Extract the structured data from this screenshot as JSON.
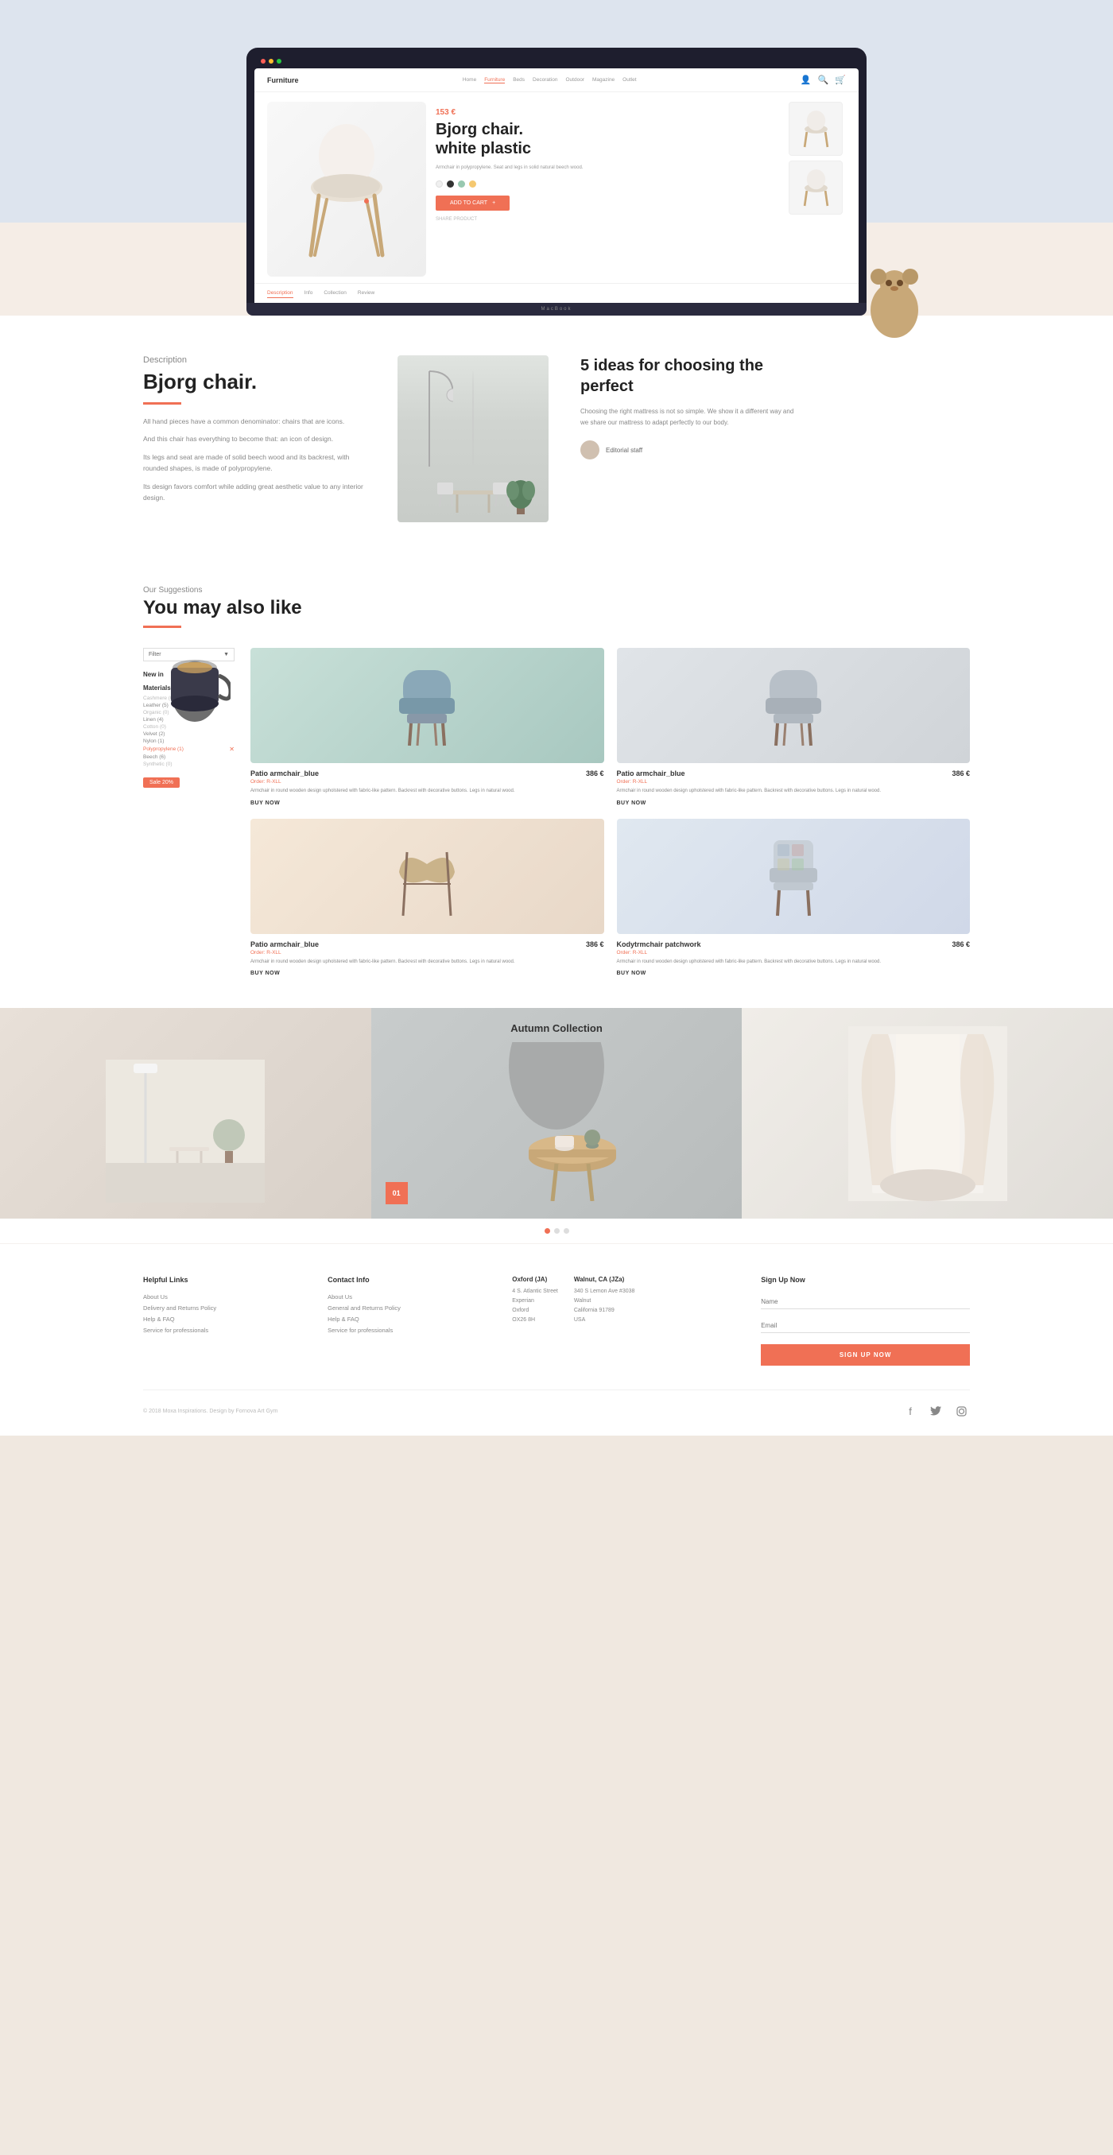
{
  "brand": {
    "logo": "Furniture"
  },
  "nav": {
    "links": [
      "Home",
      "Furniture",
      "Beds",
      "Decoration",
      "Outdoor",
      "Magazine",
      "Outlet"
    ],
    "active": "Furniture"
  },
  "product": {
    "price": "153 €",
    "title_line1": "Bjorg chair.",
    "title_line2": "white plastic",
    "description": "Armchair in polypropylene. Seat and legs in solid natural beech wood.",
    "colors": [
      "#f0f0f0",
      "#333333",
      "#c8d8c8",
      "#f5c870"
    ],
    "add_to_cart": "ADD TO CART",
    "share": "SHARE PRODUCT"
  },
  "description_section": {
    "label": "Description",
    "title": "Bjorg chair.",
    "paragraphs": [
      "All hand pieces have a common denominator: chairs that are icons.",
      "And this chair has everything to become that: an icon of design.",
      "Its legs and seat are made of solid beech wood and its backrest, with rounded shapes, is made of polypropylene.",
      "Its design favors comfort while adding great aesthetic value to any interior design."
    ],
    "ideas_title": "5 ideas for choosing the perfect",
    "ideas_text": "Choosing the right mattress is not so simple. We show it a different way and we share our mattress to adapt perfectly to our body.",
    "editorial_staff": "Editorial staff"
  },
  "suggestions": {
    "label": "Our Suggestions",
    "title": "You may also like",
    "filter_label": "Filter",
    "filter_sections": [
      {
        "title": "New in",
        "items": []
      },
      {
        "title": "Materials",
        "items": [
          {
            "label": "Cashmere (0)",
            "count": 0
          },
          {
            "label": "Leather (5)",
            "count": 5
          },
          {
            "label": "Organic (0)",
            "count": 0
          },
          {
            "label": "Linen (4)",
            "count": 4
          },
          {
            "label": "Cotton (0)",
            "count": 0
          },
          {
            "label": "Velvet (2)",
            "count": 2
          },
          {
            "label": "Nylon (1)",
            "count": 1
          },
          {
            "label": "Polypropylene (1)",
            "count": 1,
            "selected": true
          },
          {
            "label": "Beech (6)",
            "count": 6
          },
          {
            "label": "Synthetic (0)",
            "count": 0
          }
        ]
      }
    ],
    "sale_label": "Sale 20%",
    "products": [
      {
        "name": "Patio armchair_blue",
        "price": "386 €",
        "subtitle": "Order: R-XLL",
        "description": "Armchair in round wooden design upholstered with fabric-like pattern. Backrest with decorative buttons. Legs in natural wood.",
        "buy_now": "BUY NOW",
        "color": "blue-green"
      },
      {
        "name": "Patio armchair_blue",
        "price": "386 €",
        "subtitle": "Order: R-XLL",
        "description": "Armchair in round wooden design upholstered with fabric-like pattern. Backrest with decorative buttons. Legs in natural wood.",
        "buy_now": "BUY NOW",
        "color": "light-gray"
      },
      {
        "name": "Patio armchair_blue",
        "price": "386 €",
        "subtitle": "Order: R-XLL",
        "description": "Armchair in round wooden design upholstered with fabric-like pattern. Backrest with decorative buttons. Legs in natural wood.",
        "buy_now": "BUY NOW",
        "color": "peach"
      },
      {
        "name": "Kodytrmchair patchwork",
        "price": "386 €",
        "subtitle": "Order: R-XLL",
        "description": "Armchair in round wooden design upholstered with fabric-like pattern. Backrest with decorative buttons. Legs in natural wood.",
        "buy_now": "BUY NOW",
        "color": "light-blue"
      }
    ]
  },
  "autumn": {
    "title": "Autumn Collection",
    "number": "01",
    "dot_active": 0
  },
  "footer": {
    "helpful_links": {
      "title": "Helpful Links",
      "links": [
        "About Us",
        "Delivery and Returns Policy",
        "Help & FAQ",
        "Service for professionals"
      ]
    },
    "contact_info": {
      "title": "Contact Info",
      "links": [
        "About Us",
        "General and Returns Policy",
        "Help & FAQ",
        "Service for professionals"
      ]
    },
    "addresses": [
      {
        "city": "Oxford (JA)",
        "street": "4 S. Atlantic Street",
        "suite": "Experian",
        "country": "Oxford",
        "zip": "OX26 8H"
      },
      {
        "city": "Walnut, CA (JZa)",
        "street": "340 S Lemon Ave #3038",
        "street2": "Walnut",
        "country": "California 91789",
        "zip": "USA"
      }
    ],
    "signup": {
      "title": "Sign Up Now",
      "name_placeholder": "Name",
      "email_placeholder": "Email",
      "button": "SIGN UP NOW"
    },
    "copyright": "© 2018 Moxa Inspirations. Design by Fornova Art Gym",
    "social_icons": [
      "f",
      "t",
      "instagram"
    ]
  },
  "macbook_label": "MacBook"
}
